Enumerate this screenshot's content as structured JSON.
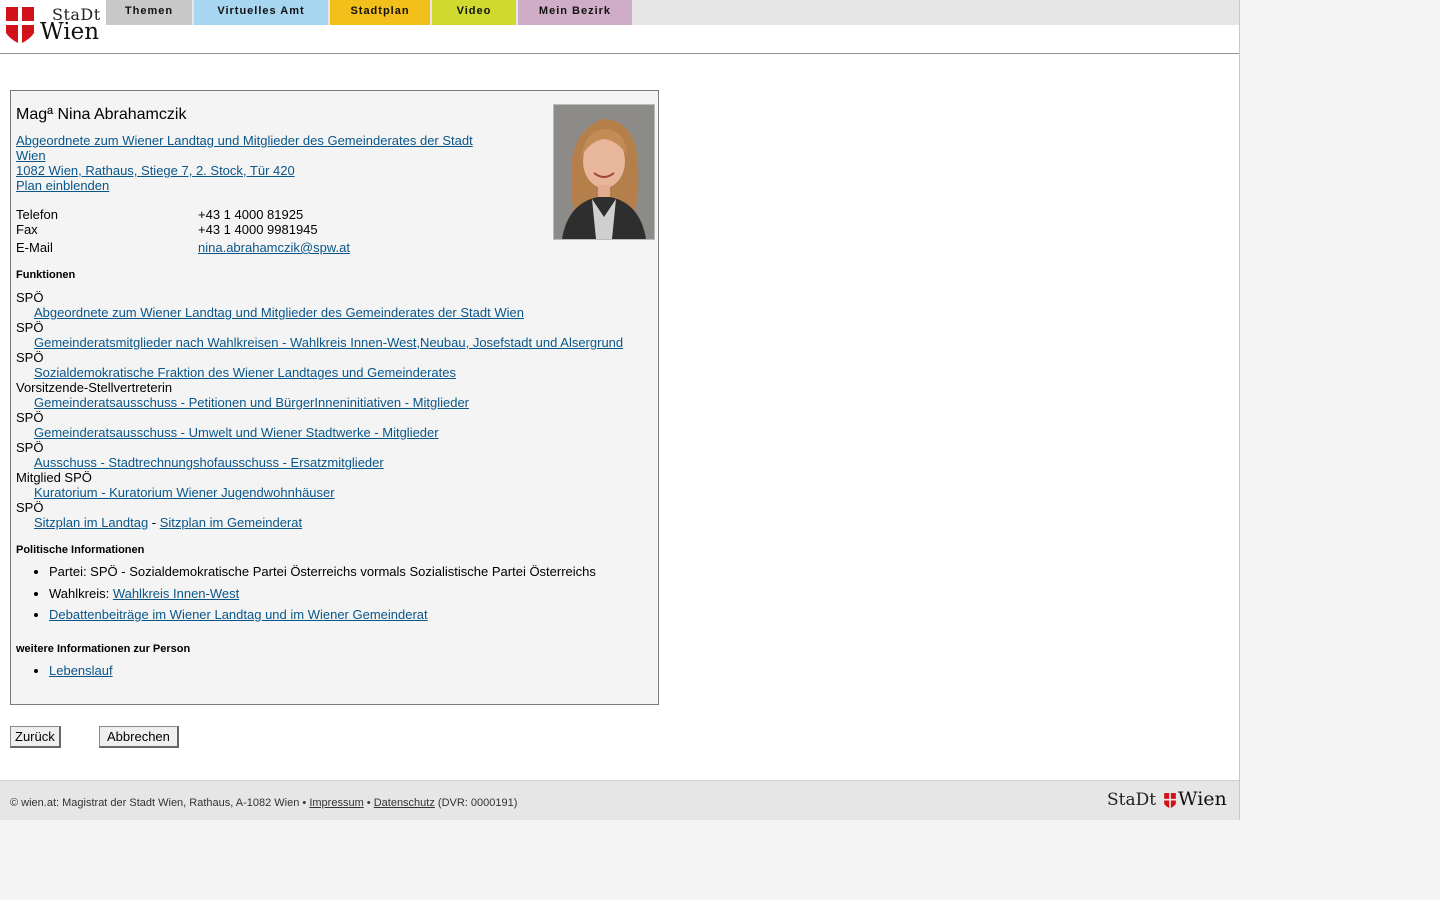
{
  "header": {
    "logo_top": "StaDt",
    "logo_bottom": "Wien",
    "nav": [
      {
        "label": "Themen",
        "color": "#c8c8c8"
      },
      {
        "label": "Virtuelles Amt",
        "color": "#a7d6f0"
      },
      {
        "label": "Stadtplan",
        "color": "#f2bf1b"
      },
      {
        "label": "Video",
        "color": "#cfd92e"
      },
      {
        "label": "Mein Bezirk",
        "color": "#cfadc6"
      }
    ]
  },
  "person": {
    "name": "Magª Nina Abrahamczik",
    "role_link_1": "Abgeordnete zum Wiener Landtag und Mitglieder des Gemeinderates der Stadt",
    "role_link_2": "Wien ",
    "address": "1082 Wien, Rathaus, Stiege 7, 2. Stock, Tür 420",
    "plan": "Plan einblenden",
    "contacts": [
      {
        "label": "Telefon",
        "value": "+43 1 4000 81925"
      },
      {
        "label": "Fax",
        "value": "+43 1 4000 9981945"
      },
      {
        "label": "E-Mail",
        "value": "nina.abrahamczik@spw.at"
      }
    ]
  },
  "funktionen": {
    "heading": "Funktionen",
    "items": [
      {
        "role": "SPÖ",
        "link": "Abgeordnete zum Wiener Landtag und Mitglieder des Gemeinderates der Stadt Wien"
      },
      {
        "role": "SPÖ",
        "link": "Gemeinderatsmitglieder nach Wahlkreisen - Wahlkreis Innen-West,Neubau, Josefstadt und Alsergrund"
      },
      {
        "role": "SPÖ",
        "link": "Sozialdemokratische Fraktion des Wiener Landtages und Gemeinderates"
      },
      {
        "role": "Vorsitzende-Stellvertreterin",
        "link": "Gemeinderatsausschuss - Petitionen und BürgerInneninitiativen - Mitglieder"
      },
      {
        "role": "SPÖ",
        "link": "Gemeinderatsausschuss - Umwelt und Wiener Stadtwerke - Mitglieder"
      },
      {
        "role": "SPÖ",
        "link": "Ausschuss - Stadtrechnungshofausschuss - Ersatzmitglieder"
      },
      {
        "role": "Mitglied SPÖ",
        "link": "Kuratorium - Kuratorium Wiener Jugendwohnhäuser"
      }
    ],
    "last_role": "SPÖ",
    "sitzplan_landtag": "Sitzplan im Landtag",
    "separator": " - ",
    "sitzplan_gemeinderat": "Sitzplan im Gemeinderat"
  },
  "politisch": {
    "heading": "Politische Informationen",
    "partei": "Partei: SPÖ - Sozialdemokratische Partei Österreichs vormals Sozialistische Partei Österreichs",
    "wahlkreis_label": "Wahlkreis: ",
    "wahlkreis_link": "Wahlkreis Innen-West",
    "debatten": "Debattenbeiträge im Wiener Landtag und im Wiener Gemeinderat"
  },
  "weitere": {
    "heading": "weitere Informationen zur Person",
    "lebenslauf": "Lebenslauf"
  },
  "buttons": {
    "back": "Zurück",
    "cancel": "Abbrechen"
  },
  "footer": {
    "text_prefix": "© wien.at: Magistrat der Stadt Wien, Rathaus, A-1082 Wien • ",
    "impressum": "Impressum",
    "bullet": " • ",
    "datenschutz": "Datenschutz",
    "dvr": " (DVR: 0000191)",
    "logo_left": "StaDt",
    "logo_right": "Wien"
  }
}
